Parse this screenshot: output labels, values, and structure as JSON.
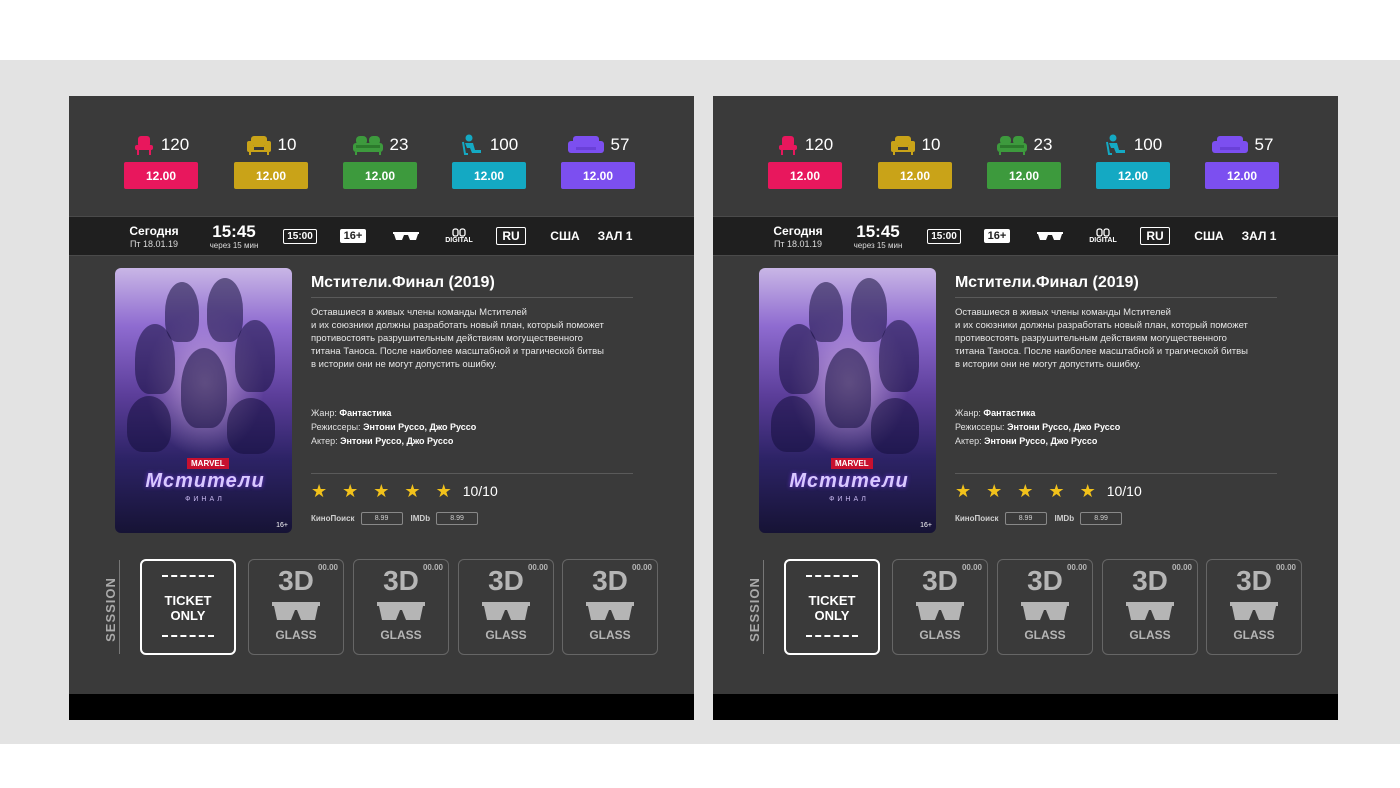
{
  "colors": {
    "pink": "#e8175d",
    "yellow": "#c9a318",
    "green": "#3d9a3d",
    "cyan": "#14a9c3",
    "purple": "#7c4ff0"
  },
  "seats": [
    {
      "icon": "chair-icon",
      "count": "120",
      "price": "12.00",
      "color": "#e8175d"
    },
    {
      "icon": "armchair-icon",
      "count": "10",
      "price": "12.00",
      "color": "#c9a318"
    },
    {
      "icon": "love-seat-icon",
      "count": "23",
      "price": "12.00",
      "color": "#3d9a3d"
    },
    {
      "icon": "recliner-icon",
      "count": "100",
      "price": "12.00",
      "color": "#14a9c3"
    },
    {
      "icon": "sofa-icon",
      "count": "57",
      "price": "12.00",
      "color": "#7c4ff0"
    }
  ],
  "info": {
    "day": "Сегодня",
    "date": "Пт 18.01.19",
    "time": "15:45",
    "in": "через 15 мин",
    "duration": "15:00",
    "age": "16+",
    "glasses_icon": "3d-glasses-icon",
    "digital_icon": "digital-icon",
    "digital": "DIGITAL",
    "lang": "RU",
    "country": "США",
    "hall": "ЗАЛ 1"
  },
  "movie": {
    "title": "Мстители.Финал (2019)",
    "desc1": "Оставшиеся в живых члены команды Мстителей",
    "desc2": "и их союзники должны разработать новый план, который поможет",
    "desc3": "противостоять разрушительным действиям могущественного",
    "desc4": "титана Таноса. После наиболее масштабной и трагической битвы",
    "desc5": "в истории они не могут допустить ошибку.",
    "genre_label": "Жанр:",
    "genre": "Фантастика",
    "directors_label": "Режиссеры:",
    "directors": "Энтони Руссо, Джо Руссо",
    "actors_label": "Актер:",
    "actors": "Энтони Руссо, Джо Руссо",
    "rating": "10/10",
    "stars": 5,
    "kp_label": "КиноПоиск",
    "kp_value": "8.99",
    "imdb_label": "IMDb",
    "imdb_value": "8.99",
    "poster_brand": "MARVEL",
    "poster_title": "Мстители",
    "poster_sub": "ФИНАЛ",
    "poster_age": "16+"
  },
  "session": {
    "label": "SESSION",
    "ticket_line1": "TICKET",
    "ticket_line2": "ONLY",
    "options": [
      {
        "d3": "3D",
        "price": "00.00",
        "glass": "GLASS"
      },
      {
        "d3": "3D",
        "price": "00.00",
        "glass": "GLASS"
      },
      {
        "d3": "3D",
        "price": "00.00",
        "glass": "GLASS"
      },
      {
        "d3": "3D",
        "price": "00.00",
        "glass": "GLASS"
      }
    ]
  }
}
